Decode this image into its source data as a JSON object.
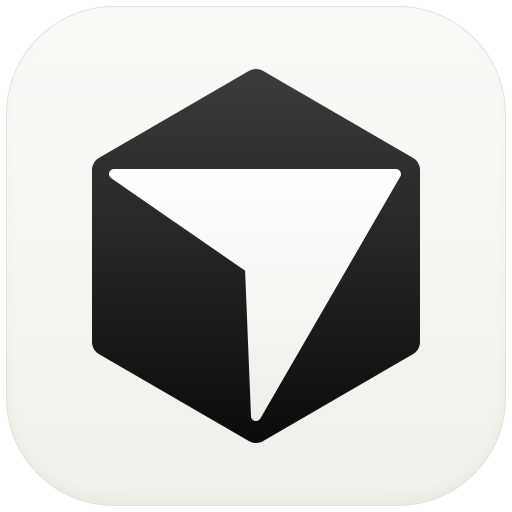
{
  "app_icon": {
    "icon": "hexagon-arrow-logo-icon",
    "colors": {
      "tile_top": "#fafaf8",
      "tile_bottom": "#f1efea",
      "hexagon_top": "#3a3a3a",
      "hexagon_bottom": "#0d0d0d",
      "arrow": "#f4f2ed"
    }
  }
}
